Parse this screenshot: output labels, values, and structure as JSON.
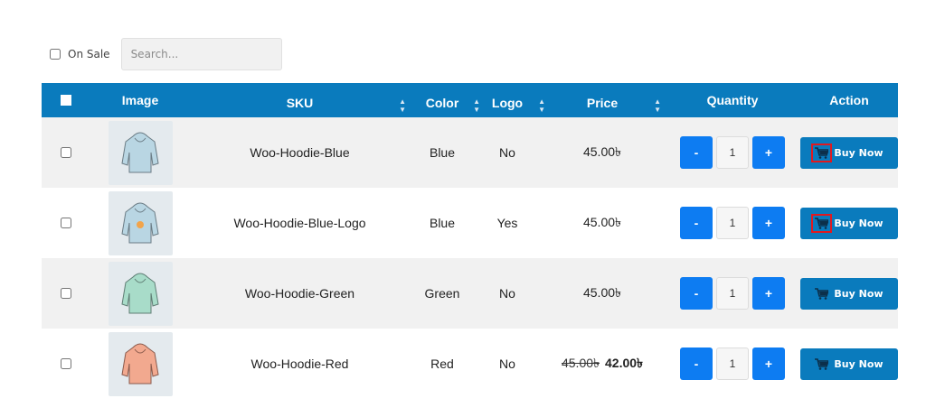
{
  "filters": {
    "on_sale_label": "On Sale",
    "search_placeholder": "Search..."
  },
  "table": {
    "headers": {
      "image": "Image",
      "sku": "SKU",
      "color": "Color",
      "logo": "Logo",
      "price": "Price",
      "quantity": "Quantity",
      "action": "Action"
    },
    "rows": [
      {
        "sku": "Woo-Hoodie-Blue",
        "color": "Blue",
        "logo": "No",
        "price": "45.00৳",
        "regular_price": "",
        "qty": "1",
        "hoodie_color": "#b9d6e3"
      },
      {
        "sku": "Woo-Hoodie-Blue-Logo",
        "color": "Blue",
        "logo": "Yes",
        "price": "45.00৳",
        "regular_price": "",
        "qty": "1",
        "hoodie_color": "#b9d6e3"
      },
      {
        "sku": "Woo-Hoodie-Green",
        "color": "Green",
        "logo": "No",
        "price": "45.00৳",
        "regular_price": "",
        "qty": "1",
        "hoodie_color": "#a8dcc9"
      },
      {
        "sku": "Woo-Hoodie-Red",
        "color": "Red",
        "logo": "No",
        "price": "42.00৳",
        "regular_price": "45.00৳",
        "qty": "1",
        "hoodie_color": "#f2a98f"
      }
    ],
    "qty_minus": "-",
    "qty_plus": "+",
    "buy_label": "Buy Now"
  },
  "colors": {
    "header_blue": "#0a7bbd",
    "qty_button_blue": "#0d7cf2",
    "highlight_red": "#e0191f"
  }
}
